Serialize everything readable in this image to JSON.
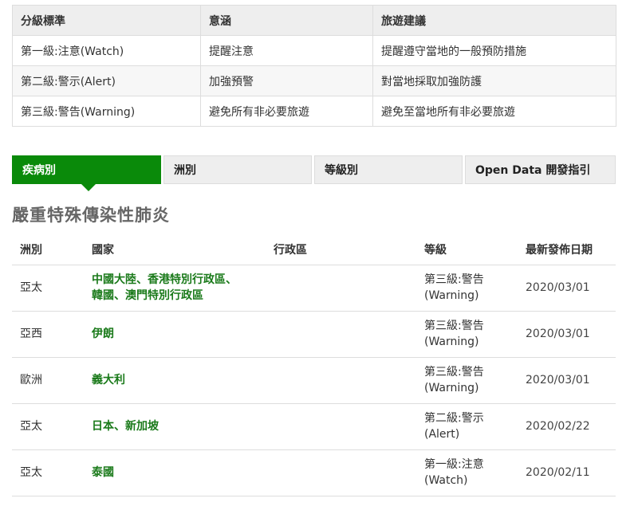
{
  "level_table": {
    "headers": [
      "分級標準",
      "意涵",
      "旅遊建議"
    ],
    "rows": [
      [
        "第一級:注意(Watch)",
        "提醒注意",
        "提醒遵守當地的一般預防措施"
      ],
      [
        "第二級:警示(Alert)",
        "加強預警",
        "對當地採取加強防護"
      ],
      [
        "第三級:警告(Warning)",
        "避免所有非必要旅遊",
        "避免至當地所有非必要旅遊"
      ]
    ]
  },
  "tabs": [
    {
      "label": "疾病別",
      "active": true
    },
    {
      "label": "洲別",
      "active": false
    },
    {
      "label": "等級別",
      "active": false
    },
    {
      "label": "Open Data 開發指引",
      "active": false
    }
  ],
  "section_title": "嚴重特殊傳染性肺炎",
  "data_table": {
    "headers": [
      "洲別",
      "國家",
      "行政區",
      "等級",
      "最新發佈日期"
    ],
    "rows": [
      {
        "region": "亞太",
        "country_line1": "中國大陸、香港特別行政區、",
        "country_line2": "韓國、澳門特別行政區",
        "district": "",
        "level_line1": "第三級:警告",
        "level_line2": "(Warning)",
        "date": "2020/03/01"
      },
      {
        "region": "亞西",
        "country_line1": "伊朗",
        "country_line2": "",
        "district": "",
        "level_line1": "第三級:警告",
        "level_line2": "(Warning)",
        "date": "2020/03/01"
      },
      {
        "region": "歐洲",
        "country_line1": "義大利",
        "country_line2": "",
        "district": "",
        "level_line1": "第三級:警告",
        "level_line2": "(Warning)",
        "date": "2020/03/01"
      },
      {
        "region": "亞太",
        "country_line1": "日本、新加坡",
        "country_line2": "",
        "district": "",
        "level_line1": "第二級:警示",
        "level_line2": "(Alert)",
        "date": "2020/02/22"
      },
      {
        "region": "亞太",
        "country_line1": "泰國",
        "country_line2": "",
        "district": "",
        "level_line1": "第一級:注意",
        "level_line2": "(Watch)",
        "date": "2020/02/11"
      }
    ]
  },
  "colors": {
    "accent": "#0a8a0a",
    "link": "#1a7a1a"
  }
}
